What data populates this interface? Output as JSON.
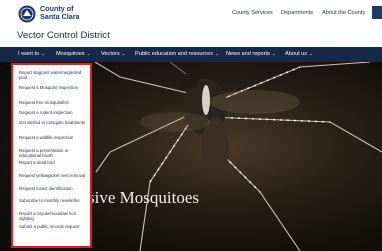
{
  "header": {
    "logo_line1": "County of",
    "logo_line2": "Santa Clara",
    "utility_links": [
      "County Services",
      "Departments",
      "About the County"
    ]
  },
  "site_title": "Vector Control District",
  "nav": {
    "items": [
      {
        "label": "I want to"
      },
      {
        "label": "Mosquitoes"
      },
      {
        "label": "Vectors"
      },
      {
        "label": "Public education and resources"
      },
      {
        "label": "News and reports"
      },
      {
        "label": "About us"
      }
    ]
  },
  "dropdown": {
    "items": [
      "Report stagnant water/neglected pool",
      "Request a Mosquito Inspection",
      "Request free mosquitofish",
      "Request a rodent inspection",
      "Get alerted to mosquito treatments",
      "Request a wildlife inspection",
      "Request a presentation or educational booth",
      "Report a dead bird",
      "Request yellowjacket nest removal",
      "Request insect identification",
      "Subscribe to monthly newsletter",
      "Report a coyote/mountain lion sighting",
      "Submit a public records request"
    ]
  },
  "hero": {
    "title": "vasive Mosquitoes"
  },
  "colors": {
    "navbar": "#16294a",
    "highlight_border": "#e02020"
  }
}
